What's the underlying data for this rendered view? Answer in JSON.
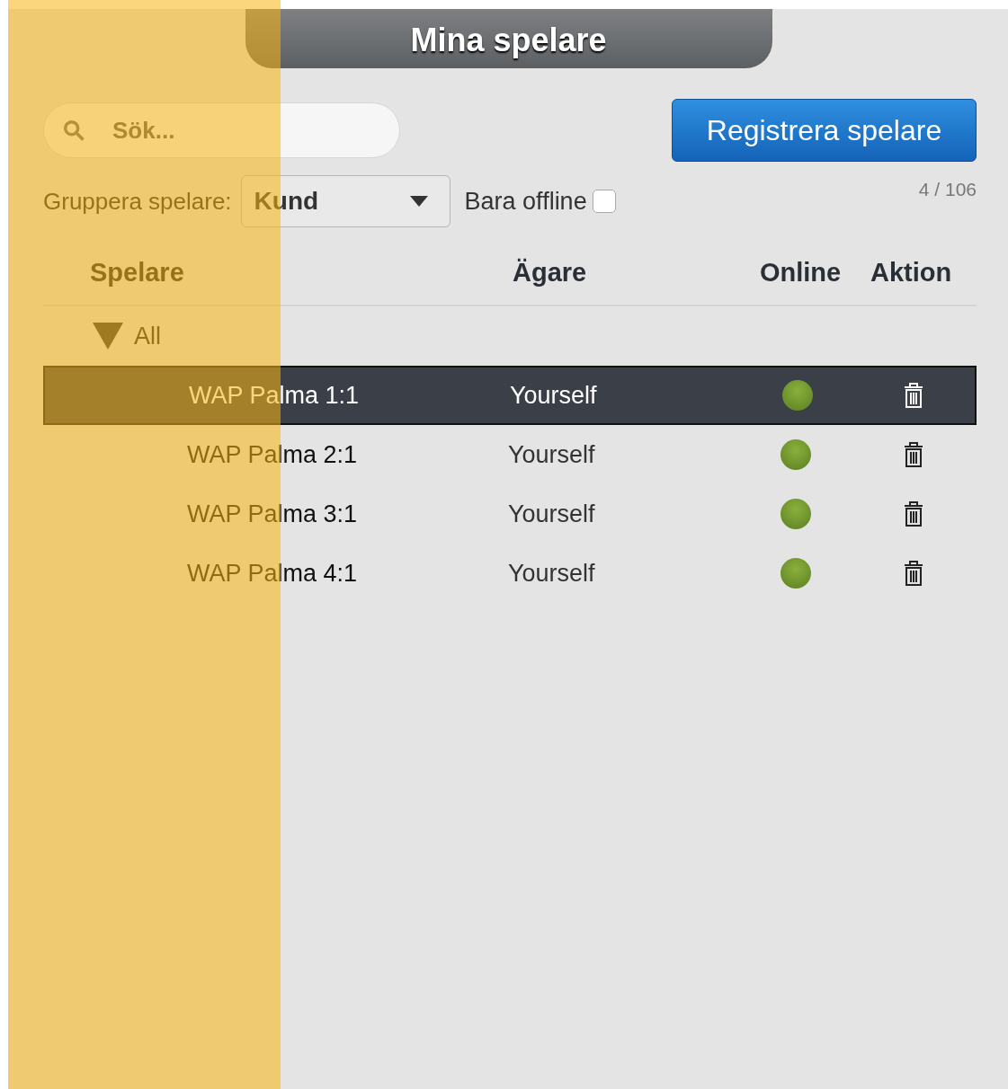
{
  "title": "Mina spelare",
  "search": {
    "placeholder": "Sök..."
  },
  "register_button": "Registrera spelare",
  "group_by": {
    "label": "Gruppera spelare:",
    "value": "Kund"
  },
  "offline_filter": {
    "label": "Bara offline",
    "checked": false
  },
  "count": "4 / 106",
  "columns": [
    "Spelare",
    "Ägare",
    "Online",
    "Aktion"
  ],
  "group": {
    "label": "All",
    "expanded": true
  },
  "rows": [
    {
      "name": "WAP Palma 1:1",
      "owner": "Yourself",
      "online": true,
      "selected": true
    },
    {
      "name": "WAP Palma 2:1",
      "owner": "Yourself",
      "online": true,
      "selected": false
    },
    {
      "name": "WAP Palma 3:1",
      "owner": "Yourself",
      "online": true,
      "selected": false
    },
    {
      "name": "WAP Palma 4:1",
      "owner": "Yourself",
      "online": true,
      "selected": false
    }
  ]
}
